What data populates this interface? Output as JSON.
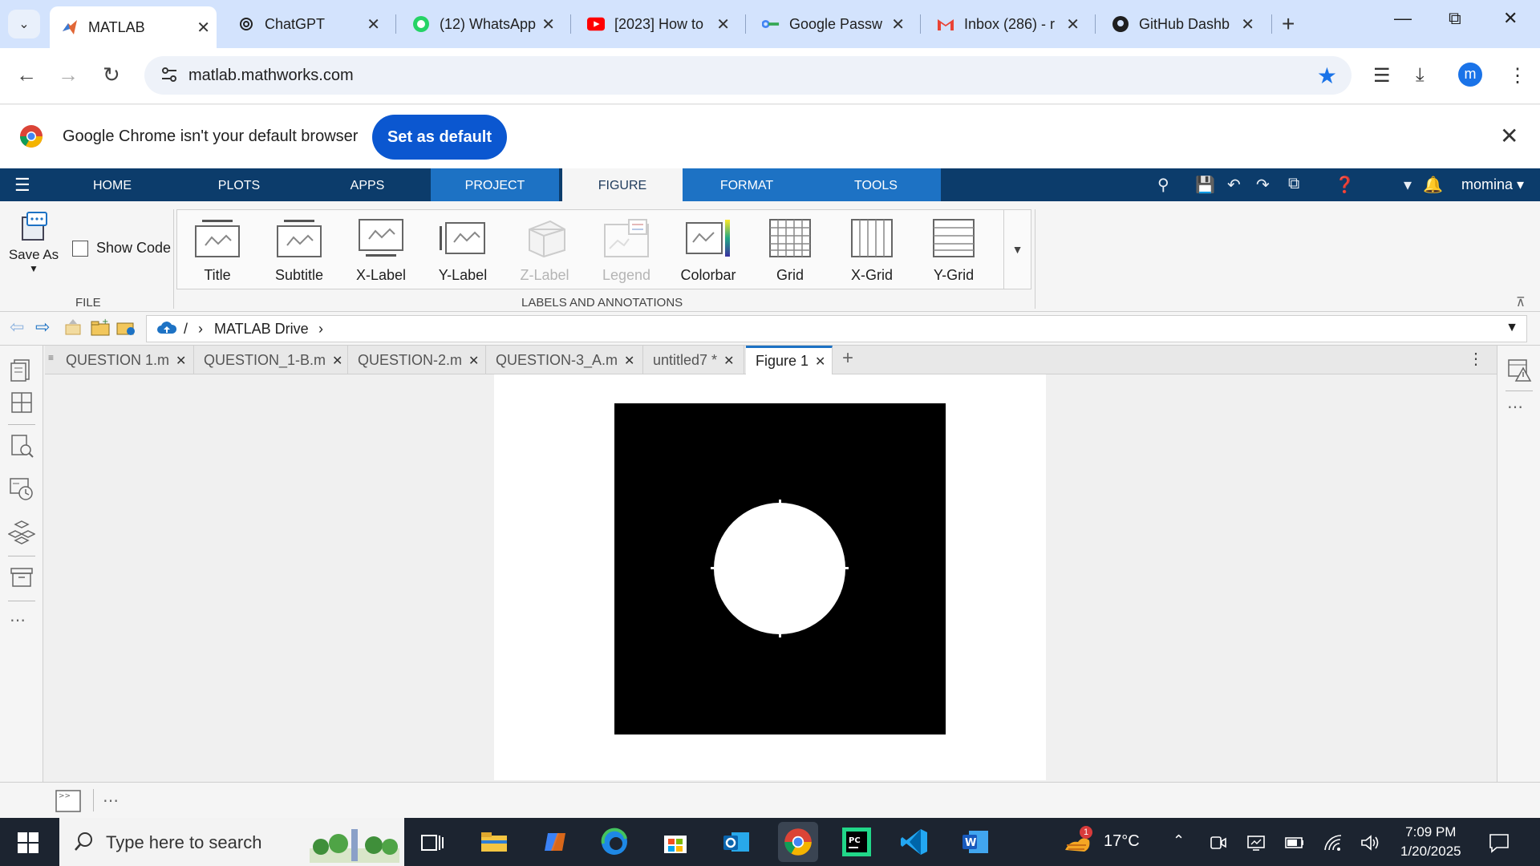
{
  "browser": {
    "tabs": [
      {
        "title": "MATLAB",
        "active": true
      },
      {
        "title": "ChatGPT",
        "active": false
      },
      {
        "title": "(12) WhatsApp",
        "active": false
      },
      {
        "title": "[2023] How to",
        "active": false
      },
      {
        "title": "Google Passw",
        "active": false
      },
      {
        "title": "Inbox (286) - r",
        "active": false
      },
      {
        "title": "GitHub Dashb",
        "active": false
      }
    ],
    "url": "matlab.mathworks.com",
    "profile_initial": "m",
    "infobar": {
      "message": "Google Chrome isn't your default browser",
      "button": "Set as default"
    }
  },
  "matlab": {
    "toolstrip_tabs": [
      "HOME",
      "PLOTS",
      "APPS",
      "PROJECT",
      "FIGURE",
      "FORMAT",
      "TOOLS"
    ],
    "active_tab": "FIGURE",
    "user": "momina",
    "file_group": {
      "save_as": "Save As",
      "show_code": "Show Code",
      "label": "FILE"
    },
    "annotations_group": {
      "label": "LABELS AND ANNOTATIONS",
      "buttons": [
        {
          "label": "Title",
          "enabled": true
        },
        {
          "label": "Subtitle",
          "enabled": true
        },
        {
          "label": "X-Label",
          "enabled": true
        },
        {
          "label": "Y-Label",
          "enabled": true
        },
        {
          "label": "Z-Label",
          "enabled": false
        },
        {
          "label": "Legend",
          "enabled": false
        },
        {
          "label": "Colorbar",
          "enabled": true
        },
        {
          "label": "Grid",
          "enabled": true
        },
        {
          "label": "X-Grid",
          "enabled": true
        },
        {
          "label": "Y-Grid",
          "enabled": true
        }
      ]
    },
    "path": {
      "root": "/",
      "folder": "MATLAB Drive"
    },
    "document_tabs": [
      {
        "label": "QUESTION 1.m",
        "active": false
      },
      {
        "label": "QUESTION_1-B.m",
        "active": false
      },
      {
        "label": "QUESTION-2.m",
        "active": false
      },
      {
        "label": "QUESTION-3_A.m",
        "active": false
      },
      {
        "label": "untitled7 *",
        "active": false
      },
      {
        "label": "Figure 1",
        "active": true
      }
    ],
    "figure": {
      "description_colors": {
        "background": "#000000",
        "shape": "#ffffff"
      }
    }
  },
  "taskbar": {
    "search_placeholder": "Type here to search",
    "weather": "17°C",
    "weather_badge": "1",
    "time": "7:09 PM",
    "date": "1/20/2025"
  },
  "colors": {
    "matlab_header": "#0c3c6b",
    "matlab_context_tab": "#1d72c4",
    "chrome_accent": "#0b57d0"
  }
}
